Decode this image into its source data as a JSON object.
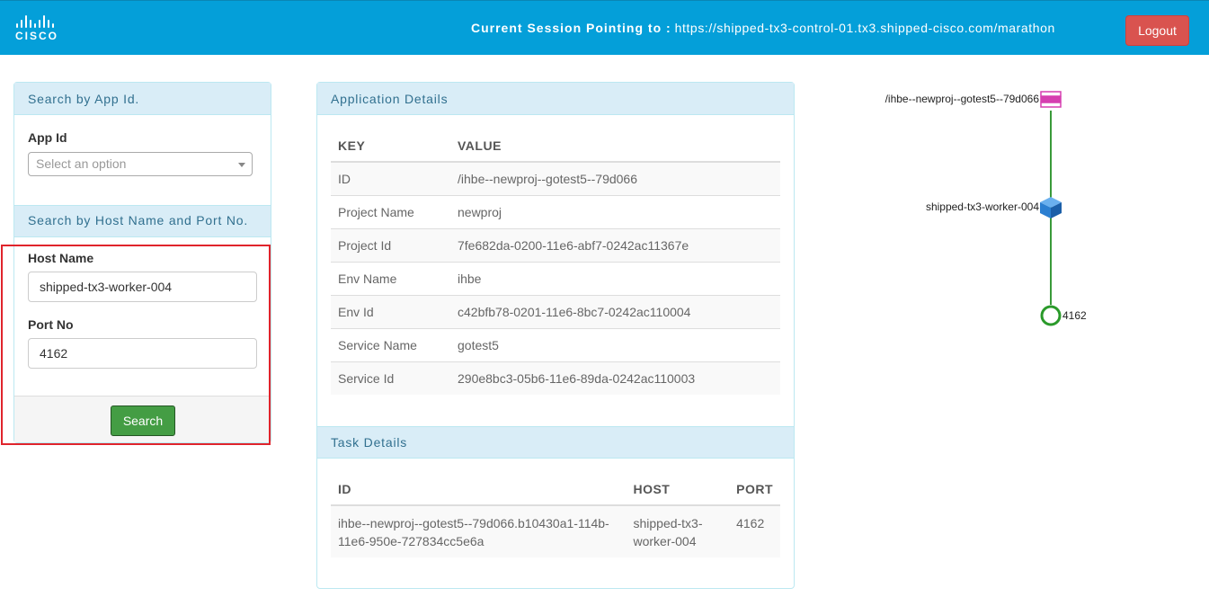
{
  "navbar": {
    "logo_text": "CISCO",
    "logo_icon": "cisco-bars-icon",
    "session_label": "Current Session Pointing to :",
    "session_url": "https://shipped-tx3-control-01.tx3.shipped-cisco.com/marathon",
    "logout_label": "Logout"
  },
  "search_app": {
    "heading": "Search by App Id.",
    "app_id_label": "App Id",
    "app_id_placeholder": "Select an option"
  },
  "search_host": {
    "heading": "Search by Host Name and Port No.",
    "host_label": "Host Name",
    "host_value": "shipped-tx3-worker-004",
    "port_label": "Port No",
    "port_value": "4162",
    "search_label": "Search"
  },
  "app_details": {
    "heading": "Application Details",
    "columns": [
      "KEY",
      "VALUE"
    ],
    "rows": [
      [
        "ID",
        "/ihbe--newproj--gotest5--79d066"
      ],
      [
        "Project Name",
        "newproj"
      ],
      [
        "Project Id",
        "7fe682da-0200-11e6-abf7-0242ac11367e"
      ],
      [
        "Env Name",
        "ihbe"
      ],
      [
        "Env Id",
        "c42bfb78-0201-11e6-8bc7-0242ac110004"
      ],
      [
        "Service Name",
        "gotest5"
      ],
      [
        "Service Id",
        "290e8bc3-05b6-11e6-89da-0242ac110003"
      ]
    ]
  },
  "task_details": {
    "heading": "Task Details",
    "columns": [
      "ID",
      "HOST",
      "PORT"
    ],
    "rows": [
      [
        "ihbe--newproj--gotest5--79d066.b10430a1-114b-11e6-950e-727834cc5e6a",
        "shipped-tx3-worker-004",
        "4162"
      ]
    ]
  },
  "graph": {
    "app_node": "/ihbe--newproj--gotest5--79d066",
    "host_node": "shipped-tx3-worker-004",
    "port_node": "4162",
    "colors": {
      "app": "#d63fb0",
      "host": "#2b7fd1",
      "port": "#2a9a2a",
      "edge": "#3a9a3a"
    }
  }
}
